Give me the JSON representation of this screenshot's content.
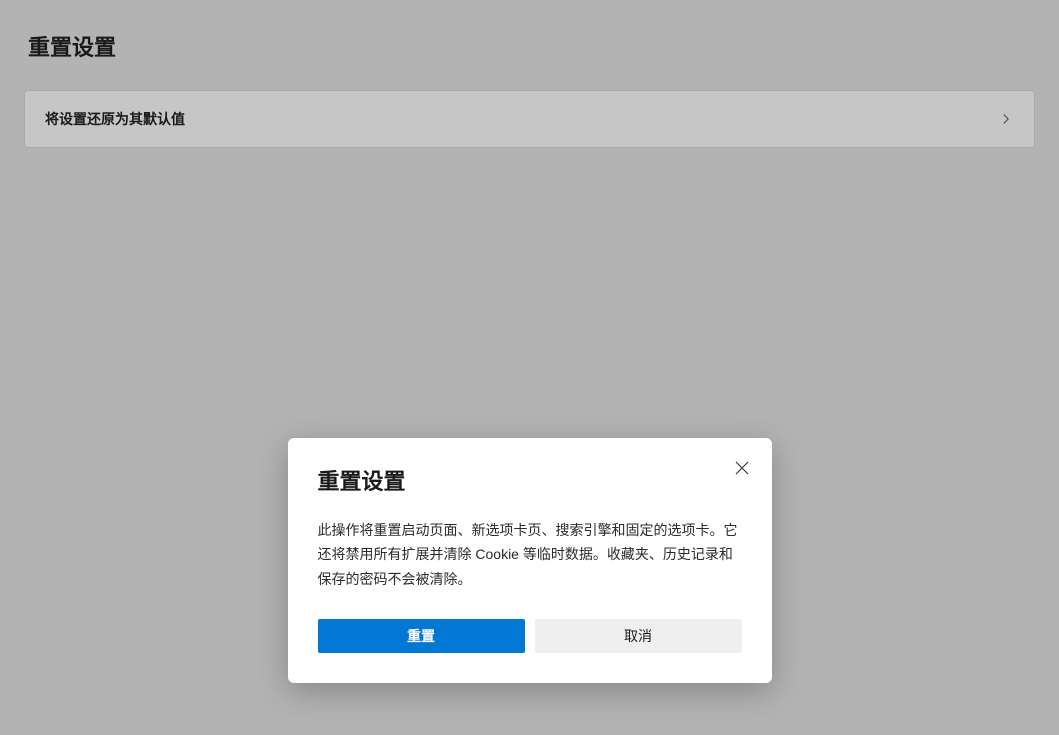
{
  "page": {
    "title": "重置设置"
  },
  "settings": {
    "resetRow": {
      "label": "将设置还原为其默认值"
    }
  },
  "dialog": {
    "title": "重置设置",
    "body": "此操作将重置启动页面、新选项卡页、搜索引擎和固定的选项卡。它还将禁用所有扩展并清除 Cookie 等临时数据。收藏夹、历史记录和保存的密码不会被清除。",
    "primaryLabel": "重置",
    "secondaryLabel": "取消"
  }
}
